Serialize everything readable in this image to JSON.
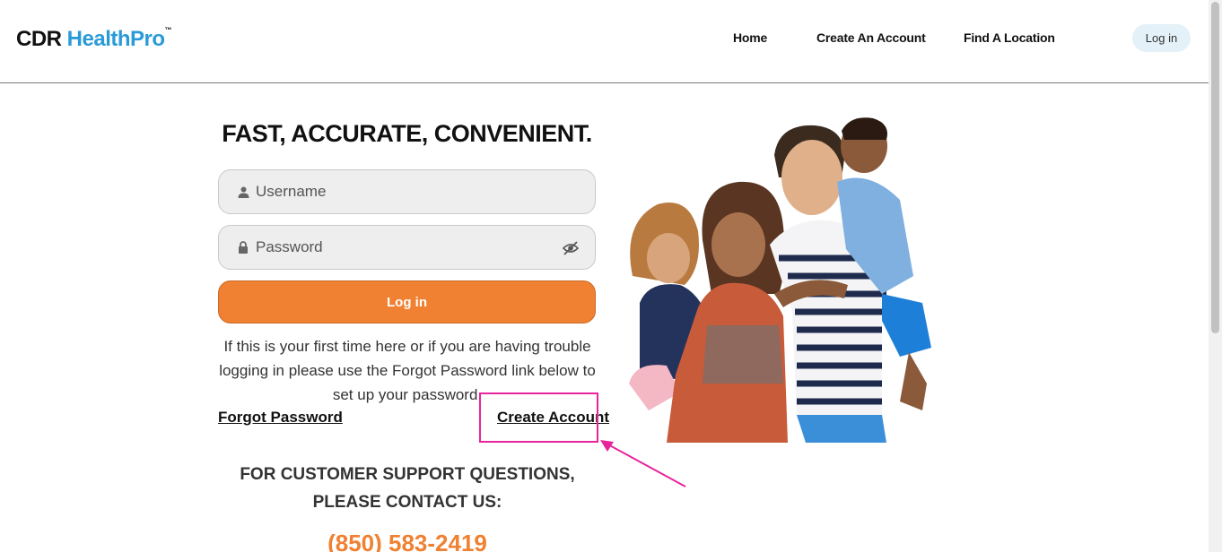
{
  "header": {
    "logo": {
      "part1": "CDR",
      "part2": "HealthPro",
      "tm": "™"
    },
    "nav": [
      {
        "label": "Home"
      },
      {
        "label": "Create An Account"
      },
      {
        "label": "Find A Location"
      }
    ],
    "login_label": "Log in"
  },
  "main": {
    "headline": "FAST, ACCURATE, CONVENIENT.",
    "username_placeholder": "Username",
    "password_placeholder": "Password",
    "login_button": "Log in",
    "help_text": "If this is your first time here or if you are having trouble logging in please use the Forgot Password link below to set up your password.",
    "forgot_password": "Forgot Password",
    "create_account": "Create Account",
    "support_text": "FOR CUSTOMER SUPPORT QUESTIONS, PLEASE CONTACT US:",
    "phone": "(850) 583-2419"
  },
  "icons": {
    "user": "user-icon",
    "lock": "lock-icon",
    "eye": "eye-slash-icon"
  },
  "colors": {
    "brand_blue": "#2a9bd8",
    "accent_orange": "#f08132",
    "highlight_pink": "#e6259c",
    "login_pill_bg": "#e4f1f8"
  }
}
